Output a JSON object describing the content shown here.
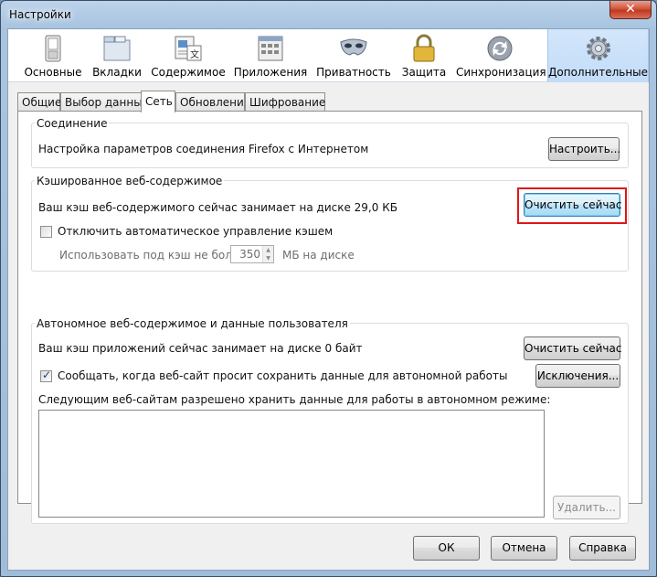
{
  "window": {
    "title": "Настройки",
    "close_label": "✕"
  },
  "toolbar": {
    "panes": [
      {
        "label": "Основные",
        "icon": "switch-icon"
      },
      {
        "label": "Вкладки",
        "icon": "tabs-icon"
      },
      {
        "label": "Содержимое",
        "icon": "content-icon"
      },
      {
        "label": "Приложения",
        "icon": "applications-icon"
      },
      {
        "label": "Приватность",
        "icon": "mask-icon"
      },
      {
        "label": "Защита",
        "icon": "padlock-icon"
      },
      {
        "label": "Синхронизация",
        "icon": "sync-icon"
      },
      {
        "label": "Дополнительные",
        "icon": "gear-icon"
      }
    ],
    "selected": "Дополнительные"
  },
  "tabs": {
    "items": [
      "Общие",
      "Выбор данных",
      "Сеть",
      "Обновления",
      "Шифрование"
    ],
    "active": "Сеть"
  },
  "connection": {
    "group_label": "Соединение",
    "description": "Настройка параметров соединения Firefox с Интернетом",
    "settings_button": "Настроить..."
  },
  "cache": {
    "group_label": "Кэшированное веб-содержимое",
    "usage_text": "Ваш кэш веб-содержимого сейчас занимает на диске 29,0 КБ",
    "clear_button": "Очистить сейчас",
    "override_checkbox_label": "Отключить автоматическое управление кэшем",
    "override_checked": false,
    "limit_prefix": "Использовать под кэш не более",
    "limit_value": "350",
    "limit_suffix": "МБ на диске"
  },
  "offline": {
    "group_label": "Автономное веб-содержимое и данные пользователя",
    "usage_text": "Ваш кэш приложений сейчас занимает на диске 0 байт",
    "clear_button": "Очистить сейчас",
    "notify_checkbox_label": "Сообщать, когда веб-сайт просит сохранить данные для автономной работы",
    "notify_checked": true,
    "exceptions_button": "Исключения...",
    "list_label": "Следующим веб-сайтам разрешено хранить данные для работы в автономном режиме:",
    "remove_button": "Удалить..."
  },
  "footer": {
    "ok_button": "ОК",
    "cancel_button": "Отмена",
    "help_button": "Справка"
  },
  "colors": {
    "highlight_box": "#e01717",
    "selected_pane": "#c2dcf8"
  }
}
